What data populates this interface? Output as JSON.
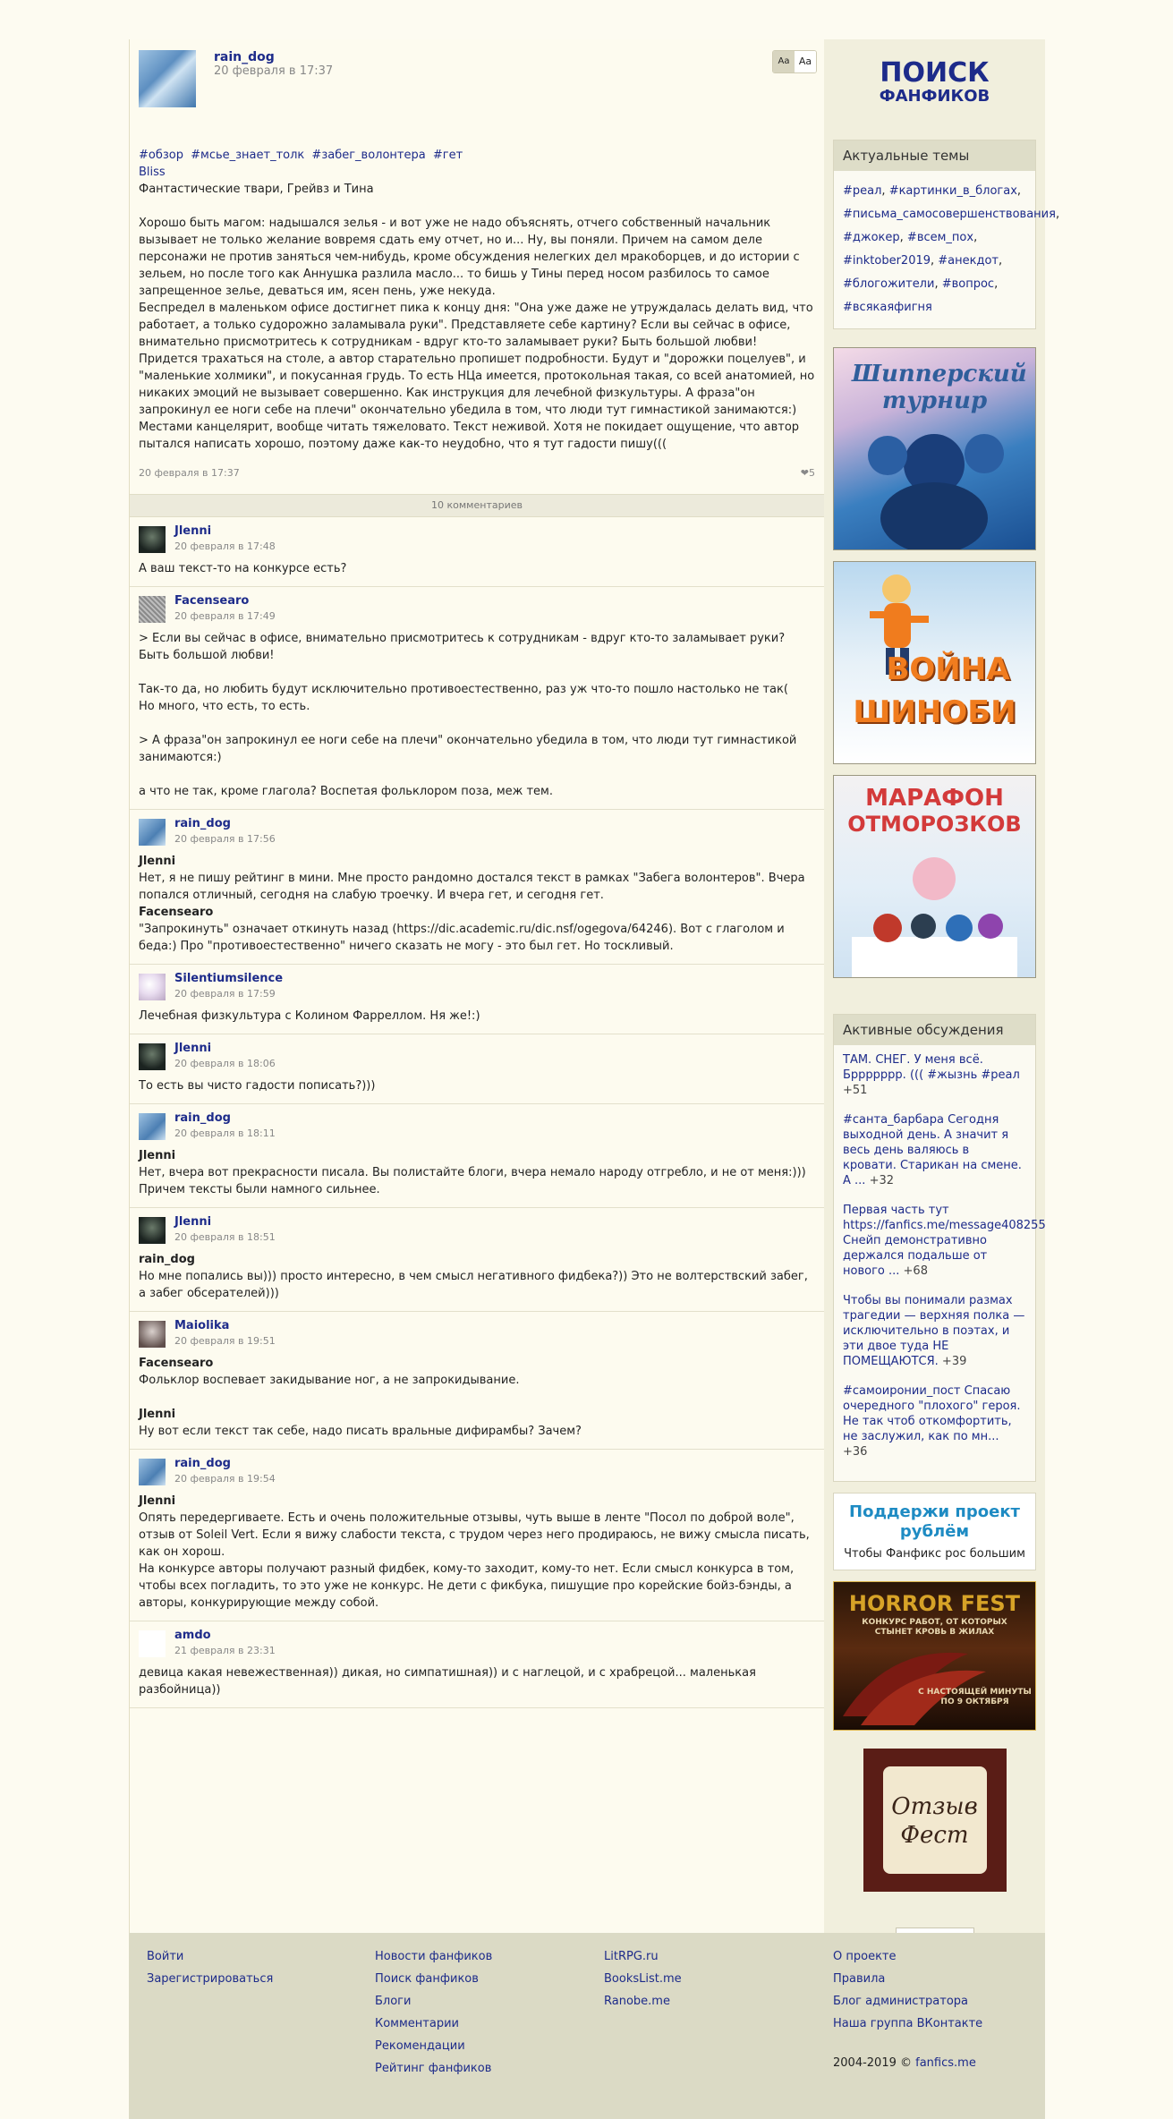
{
  "post": {
    "author": "rain_dog",
    "date": "20 февраля в 17:37",
    "font_small": "Aa",
    "font_big": "Aa",
    "tags": [
      "#обзор",
      "#мсье_знает_толк",
      "#забег_волонтера",
      "#гет"
    ],
    "link_title": "Bliss",
    "subtitle": "Фантастические твари, Грейвз и Тина",
    "paragraph1": "Хорошо быть магом: надышался зелья - и вот уже не надо объяснять, отчего собственный начальник вызывает не только желание вовремя сдать ему отчет, но и... Ну, вы поняли. Причем на самом деле персонажи не против заняться чем-нибудь, кроме обсуждения нелегких дел мракоборцев, и до истории с зельем, но после того как Аннушка разлила масло... то бишь у Тины перед носом разбилось то самое запрещенное зелье, деваться им, ясен пень, уже некуда.",
    "paragraph2": "Беспредел в маленьком офисе достигнет пика к концу дня: \"Она уже даже не утруждалась делать вид, что работает, а только судорожно заламывала руки\". Представляете себе картину? Если вы сейчас в офисе, внимательно присмотритесь к сотрудникам - вдруг кто-то заламывает руки? Быть большой любви! Придется трахаться на столе, а автор старательно пропишет подробности. Будут и \"дорожки поцелуев\", и \"маленькие холмики\", и покусанная грудь. То есть НЦа имеется, протокольная такая, со всей анатомией, но никаких эмоций не вызывает совершенно. Как инструкция для лечебной физкультуры. А фраза\"он запрокинул ее ноги себе на плечи\" окончательно убедила в том, что люди тут гимнастикой занимаются:)",
    "paragraph3": "Местами канцелярит, вообще читать тяжеловато. Текст неживой. Хотя не покидает ощущение, что автор пытался написать хорошо, поэтому даже как-то неудобно, что я тут гадости пишу(((",
    "footer_date": "20 февраля в 17:37",
    "likes": "5",
    "comments_count": "10 комментариев"
  },
  "comments": [
    {
      "author": "Jlenni",
      "date": "20 февраля в 17:48",
      "lines": [
        {
          "t": "А ваш текст-то на конкурсе есть?"
        }
      ]
    },
    {
      "author": "Facensearo",
      "date": "20 февраля в 17:49",
      "lines": [
        {
          "t": "> Если вы сейчас в офисе, внимательно присмотритесь к сотрудникам - вдруг кто-то заламывает руки? Быть большой любви!"
        },
        {
          "t": ""
        },
        {
          "t": "Так-то да, но любить будут исключительно противоестественно, раз уж что-то пошло настолько не так("
        },
        {
          "t": "Но много, что есть, то есть."
        },
        {
          "t": ""
        },
        {
          "t": "> А фраза\"он запрокинул ее ноги себе на плечи\" окончательно убедила в том, что люди тут гимнастикой занимаются:)"
        },
        {
          "t": ""
        },
        {
          "t": "а что не так, кроме глагола? Воспетая фольклором поза, меж тем."
        }
      ]
    },
    {
      "author": "rain_dog",
      "date": "20 февраля в 17:56",
      "lines": [
        {
          "t": "Jlenni",
          "b": true
        },
        {
          "t": "Нет, я не пишу рейтинг в мини. Мне просто рандомно достался текст в рамках \"Забега волонтеров\". Вчера попался отличный, сегодня на слабую троечку. И вчера гет, и сегодня гет."
        },
        {
          "t": "Facensearo",
          "b": true
        },
        {
          "t": "\"Запрокинуть\" означает откинуть назад (https://dic.academic.ru/dic.nsf/ogegova/64246). Вот с глаголом и беда:) Про \"противоестественно\" ничего сказать не могу - это был гет. Но тоскливый."
        }
      ]
    },
    {
      "author": "Silentiumsilence",
      "date": "20 февраля в 17:59",
      "lines": [
        {
          "t": "Лечебная физкультура с Колином Фарреллом. Ня же!:)"
        }
      ]
    },
    {
      "author": "Jlenni",
      "date": "20 февраля в 18:06",
      "lines": [
        {
          "t": "То есть вы чисто гадости пописать?)))"
        }
      ]
    },
    {
      "author": "rain_dog",
      "date": "20 февраля в 18:11",
      "lines": [
        {
          "t": "Jlenni",
          "b": true
        },
        {
          "t": "Нет, вчера вот прекрасности писала. Вы полистайте блоги, вчера немало народу отгребло, и не от меня:))) Причем тексты были намного сильнее."
        }
      ]
    },
    {
      "author": "Jlenni",
      "date": "20 февраля в 18:51",
      "lines": [
        {
          "t": "rain_dog",
          "b": true
        },
        {
          "t": "Но мне попались вы))) просто интересно, в чем смысл негативного фидбека?)) Это не волтерствский забег, а забег обсерателей)))"
        }
      ]
    },
    {
      "author": "Maiolika",
      "date": "20 февраля в 19:51",
      "lines": [
        {
          "t": "Facensearo",
          "b": true
        },
        {
          "t": "Фольклор воспевает закидывание ног, а не запрокидывание."
        },
        {
          "t": ""
        },
        {
          "t": "Jlenni",
          "b": true
        },
        {
          "t": "Ну вот если текст так себе, надо писать вральные дифирамбы? Зачем?"
        }
      ]
    },
    {
      "author": "rain_dog",
      "date": "20 февраля в 19:54",
      "lines": [
        {
          "t": "Jlenni",
          "b": true
        },
        {
          "t": "Опять передергиваете. Есть и очень положительные отзывы, чуть выше в ленте \"Посол по доброй воле\", отзыв от Soleil Vert. Если я вижу слабости текста, с трудом через него продираюсь, не вижу смысла писать, как он хорош."
        },
        {
          "t": "На конкурсе авторы получают разный фидбек, кому-то заходит, кому-то нет. Если смысл конкурса в том, чтобы всех погладить, то это уже не конкурс. Не дети с фикбука, пишущие про корейские бойз-бэнды, а авторы, конкурирующие между собой."
        }
      ]
    },
    {
      "author": "amdo",
      "date": "21 февраля в 23:31",
      "lines": [
        {
          "t": "девица какая невежественная)) дикая, но симпатишная)) и с наглецой, и с храбрецой... маленькая разбойница))"
        }
      ]
    }
  ],
  "sidebar": {
    "logo_line1": "ПОИСК",
    "logo_line2": "ФАНФИКОВ",
    "topics_title": "Актуальные темы",
    "topics": [
      "#реал",
      "#картинки_в_блогах",
      "#письма_самосовершенствования",
      "#джокер",
      "#всем_пох",
      "#inktober2019",
      "#анекдот",
      "#блогожители",
      "#вопрос",
      "#всякаяфигня"
    ],
    "banner1_text": "Шипперский турнир",
    "banner2_line1": "ВОЙНА",
    "banner2_line2": "ШИНОБИ",
    "banner3_line1": "МАРАФОН",
    "banner3_line2": "ОТМОРОЗКОВ",
    "discussions_title": "Активные обсуждения",
    "discussions": [
      {
        "text": "ТАМ. СНЕГ. У меня всё. Бррррррр. ((( #жызнь #реал",
        "count": "+51"
      },
      {
        "text": "#санта_барбара Сегодня выходной день. А значит я весь день валяюсь в кровати. Старикан на смене. А ...",
        "count": "+32"
      },
      {
        "text": "Первая часть тут https://fanfics.me/message408255 Снейп демонстративно держался подальше от нового ...",
        "count": "+68"
      },
      {
        "text": "Чтобы вы понимали размах трагедии — верхняя полка — исключительно в поэтах, и эти двое туда НЕ ПОМЕЩАЮТСЯ.",
        "count": "+39"
      },
      {
        "text": "#самоиронии_пост Спасаю очередного \"плохого\" героя. Не так чтоб откомфортить, не заслужил, как по мн...",
        "count": "+36"
      }
    ],
    "support_title": "Поддержи проект рублём",
    "support_sub": "Чтобы Фанфикс рос большим",
    "horror_line1": "HORROR FEST",
    "horror_line2": "КОНКУРС РАБОТ, ОТ КОТОРЫХ СТЫНЕТ КРОВЬ В ЖИЛАХ",
    "horror_line3": "С НАСТОЯЩЕЙ МИНУТЫ ПО 9 ОКТЯБРЯ",
    "otzyv_line1": "Отзыв",
    "otzyv_line2": "Фест"
  },
  "footer": {
    "col1": [
      "Войти",
      "Зарегистрироваться"
    ],
    "col2": [
      "Новости фанфиков",
      "Поиск фанфиков",
      "Блоги",
      "Комментарии",
      "Рекомендации",
      "Рейтинг фанфиков"
    ],
    "col3": [
      "LitRPG.ru",
      "BooksList.me",
      "Ranobe.me"
    ],
    "col4": [
      "О проекте",
      "Правила",
      "Блог администратора",
      "Наша группа ВКонтакте"
    ],
    "copyright": "2004-2019 ©",
    "copyright_link": "fanfics.me"
  }
}
